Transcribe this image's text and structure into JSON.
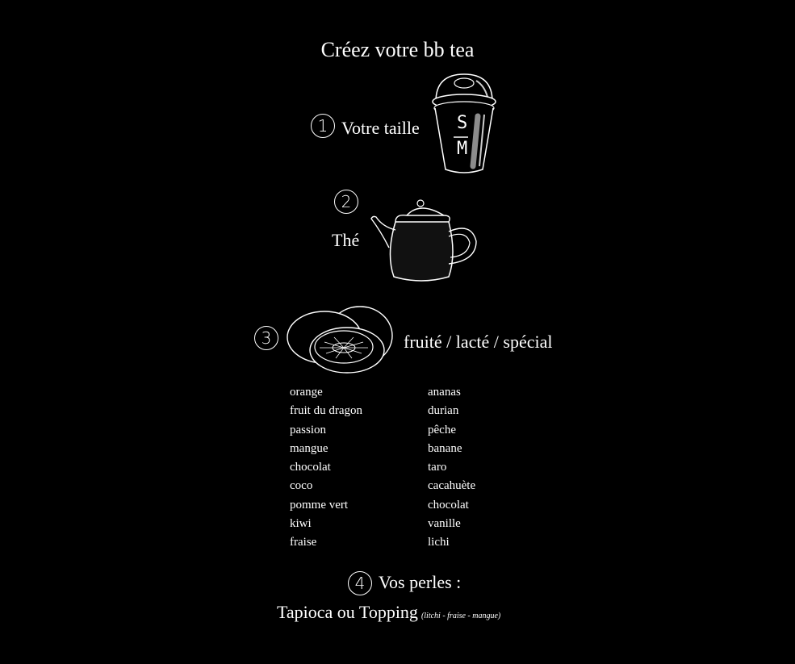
{
  "title": "Créez votre bb tea",
  "steps": {
    "size": {
      "number": "1",
      "label": "Votre taille",
      "size_top": "S",
      "size_bottom": "M",
      "icon": "cup-icon"
    },
    "tea": {
      "number": "2",
      "label": "Thé",
      "icon": "teapot-icon"
    },
    "flavor": {
      "number": "3",
      "label": "fruité / lacté / spécial",
      "icon": "fruit-icon"
    },
    "pearls": {
      "number": "4",
      "label": "Vos perles :",
      "main": "Tapioca ou Topping",
      "note": "(litchi - fraise - mangue)"
    }
  },
  "flavors_left": [
    "orange",
    "fruit du dragon",
    "passion",
    "mangue",
    "chocolat",
    "coco",
    "pomme vert",
    "kiwi",
    "fraise"
  ],
  "flavors_right": [
    "ananas",
    "durian",
    "pêche",
    "banane",
    "taro",
    "cacahuète",
    "chocolat",
    "vanille",
    "lichi"
  ],
  "colors": {
    "background": "#000000",
    "text": "#ffffff"
  }
}
